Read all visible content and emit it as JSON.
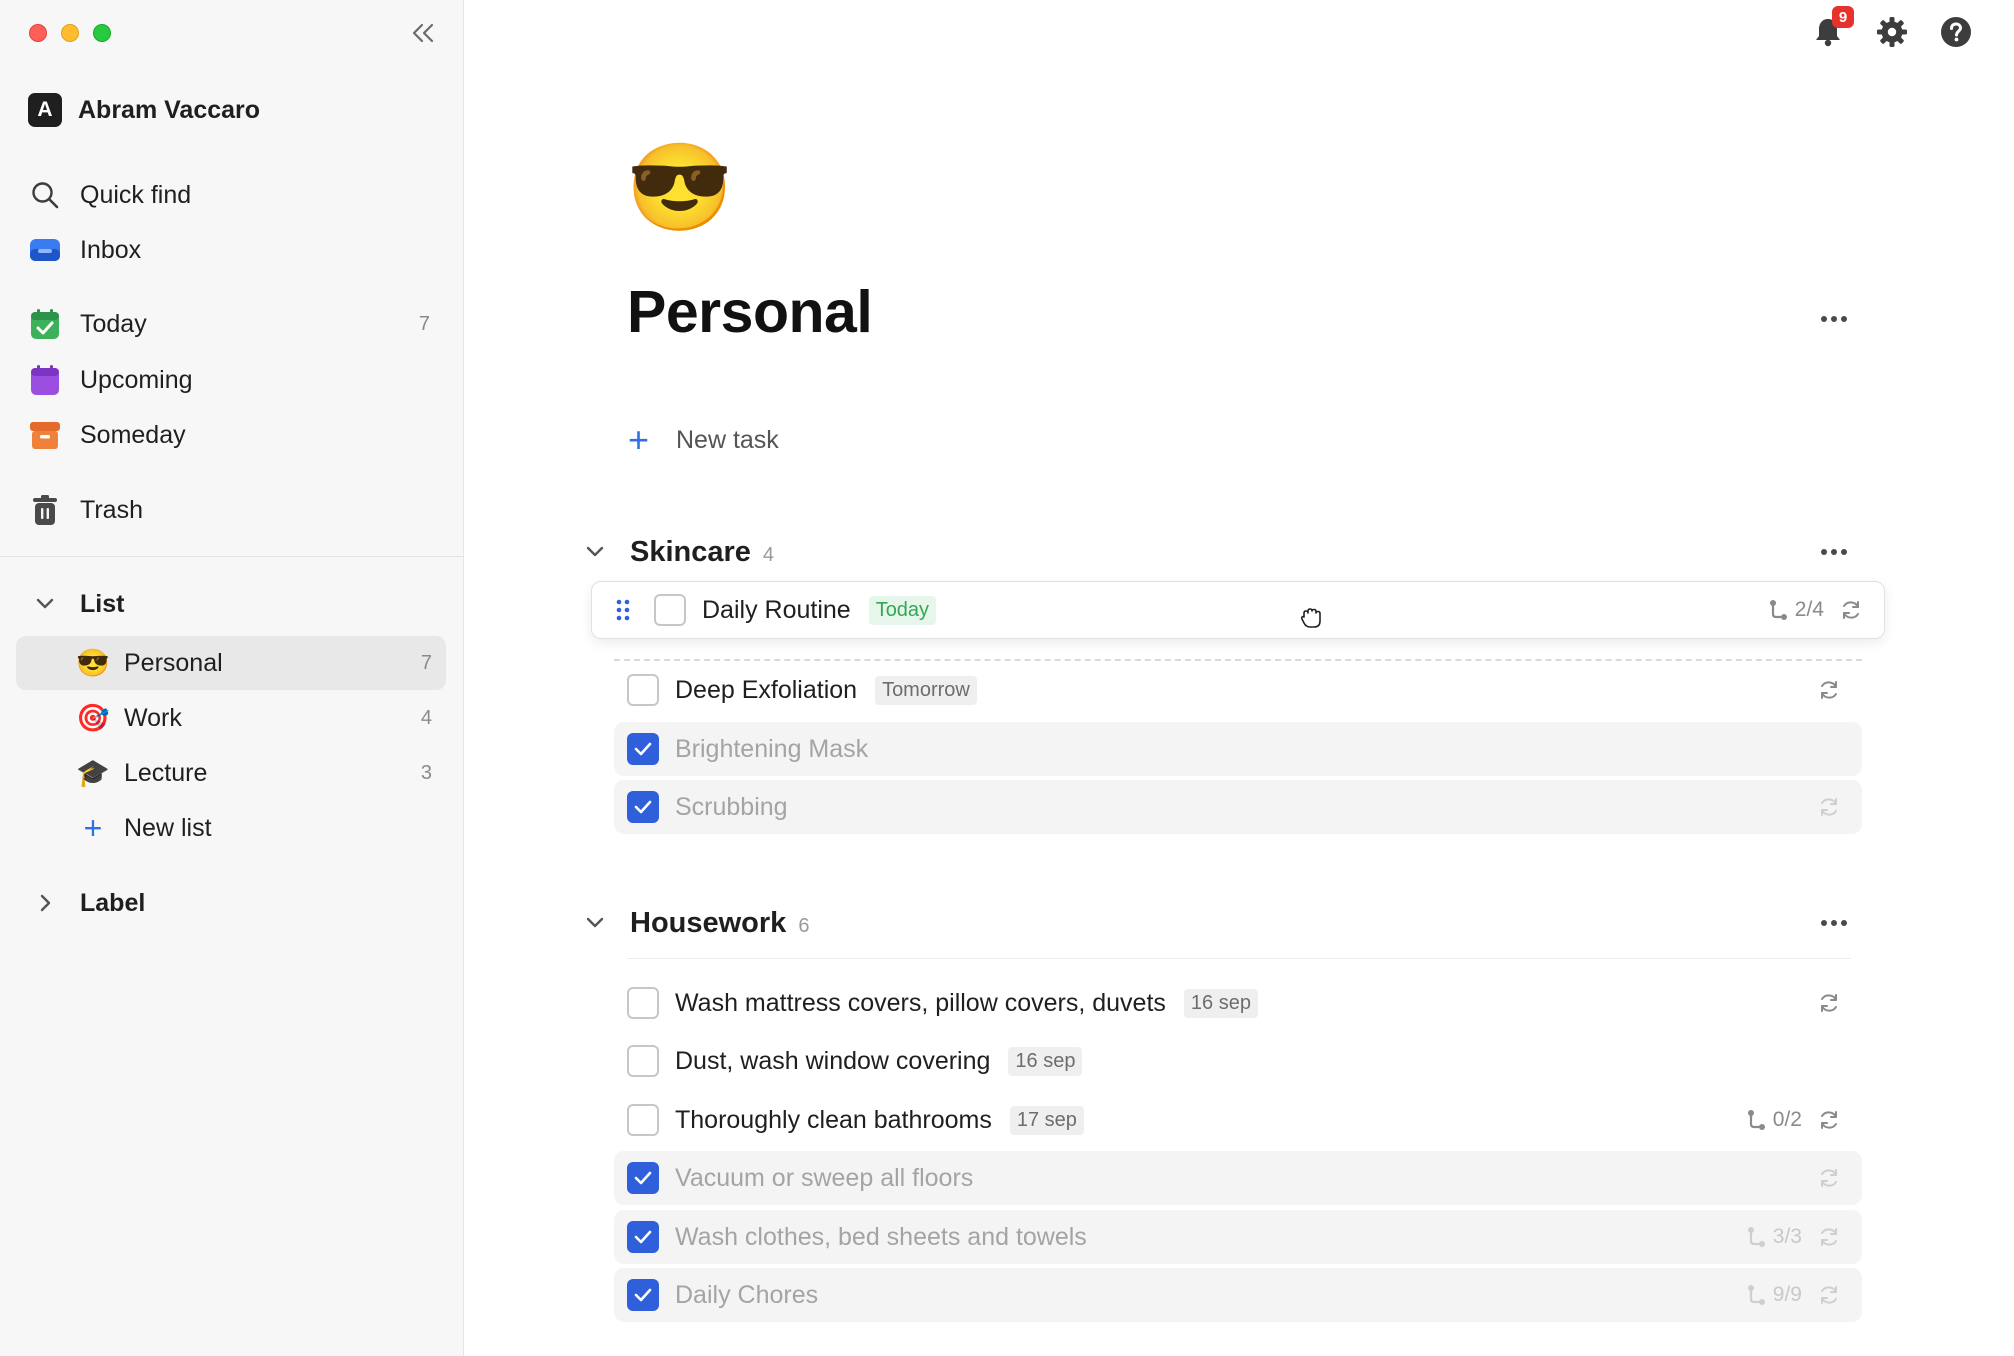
{
  "sidebar": {
    "user": {
      "initial": "A",
      "name": "Abram Vaccaro"
    },
    "nav": [
      {
        "label": "Quick find",
        "icon": "search-icon"
      },
      {
        "label": "Inbox",
        "icon": "inbox-icon"
      },
      {
        "label": "Today",
        "icon": "calendar-check-icon",
        "count": "7"
      },
      {
        "label": "Upcoming",
        "icon": "calendar-icon"
      },
      {
        "label": "Someday",
        "icon": "archive-box-icon"
      },
      {
        "label": "Trash",
        "icon": "trash-icon"
      }
    ],
    "list_section": {
      "label": "List"
    },
    "lists": [
      {
        "emoji": "😎",
        "label": "Personal",
        "count": "7"
      },
      {
        "emoji": "🎯",
        "label": "Work",
        "count": "4"
      },
      {
        "emoji": "🎓",
        "label": "Lecture",
        "count": "3"
      }
    ],
    "new_list_label": "New list",
    "label_section": {
      "label": "Label"
    }
  },
  "topbar": {
    "notification_count": "9"
  },
  "page": {
    "emoji": "😎",
    "title": "Personal",
    "new_task_label": "New task"
  },
  "groups": [
    {
      "title": "Skincare",
      "count": "4",
      "tasks": [
        {
          "name": "Daily Routine",
          "tag": "Today",
          "subtasks": "2/4",
          "repeat": true,
          "done": false,
          "dragging": true
        },
        {
          "name": "Deep Exfoliation",
          "tag": "Tomorrow",
          "repeat": true,
          "done": false
        },
        {
          "name": "Brightening Mask",
          "done": true
        },
        {
          "name": "Scrubbing",
          "repeat": true,
          "done": true
        }
      ]
    },
    {
      "title": "Housework",
      "count": "6",
      "tasks": [
        {
          "name": "Wash mattress covers, pillow covers, duvets",
          "tag": "16 sep",
          "repeat": true,
          "done": false
        },
        {
          "name": "Dust, wash window covering",
          "tag": "16 sep",
          "done": false
        },
        {
          "name": "Thoroughly clean bathrooms",
          "tag": "17 sep",
          "subtasks": "0/2",
          "repeat": true,
          "done": false
        },
        {
          "name": "Vacuum or sweep all floors",
          "repeat": true,
          "done": true
        },
        {
          "name": "Wash clothes, bed sheets and towels",
          "subtasks": "3/3",
          "repeat": true,
          "done": true
        },
        {
          "name": "Daily Chores",
          "subtasks": "9/9",
          "repeat": true,
          "done": true
        }
      ]
    }
  ],
  "colors": {
    "accent": "#2f5fdb",
    "today_tag": "#33a853",
    "badge": "#e5322d"
  }
}
